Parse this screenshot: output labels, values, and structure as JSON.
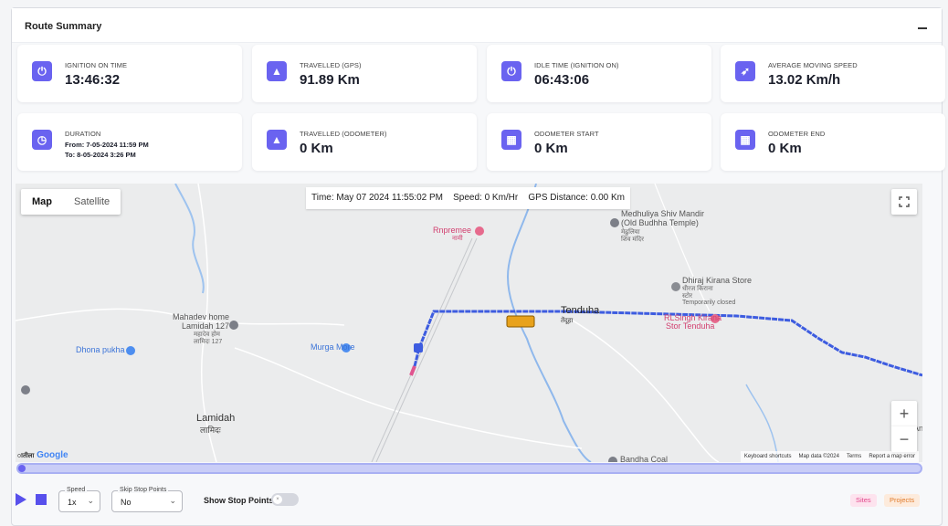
{
  "panel": {
    "title": "Route Summary"
  },
  "stats": [
    {
      "label": "IGNITION ON TIME",
      "value": "13:46:32",
      "icon": "power-icon"
    },
    {
      "label": "TRAVELLED (GPS)",
      "value": "91.89 Km",
      "icon": "road-icon"
    },
    {
      "label": "IDLE TIME (IGNITION ON)",
      "value": "06:43:06",
      "icon": "power-icon"
    },
    {
      "label": "AVERAGE MOVING SPEED",
      "value": "13.02 Km/h",
      "icon": "rocket-icon"
    },
    {
      "label": "DURATION",
      "from": "From: 7-05-2024 11:59 PM",
      "to": "To: 8-05-2024 3:26 PM",
      "icon": "clock-icon"
    },
    {
      "label": "TRAVELLED (ODOMETER)",
      "value": "0 Km",
      "icon": "road-icon"
    },
    {
      "label": "ODOMETER START",
      "value": "0 Km",
      "icon": "calculator-icon"
    },
    {
      "label": "ODOMETER END",
      "value": "0 Km",
      "icon": "calculator-icon"
    }
  ],
  "map": {
    "type_map": "Map",
    "type_satellite": "Satellite",
    "info": {
      "time": "Time: May 07 2024 11:55:02 PM",
      "speed": "Speed: 0 Km/Hr",
      "gps_distance": "GPS Distance: 0.00 Km"
    },
    "zoom_in": "+",
    "zoom_out": "−",
    "labels": {
      "temple_1": "Medhuliya Shiv Mandir",
      "temple_2": "(Old Budhha Temple)",
      "temple_3": "मेढुलिया",
      "temple_4": "शिव मंदिर",
      "rnpremee": "Rnpremee",
      "rnpremee_local": "नामी",
      "dhiraj_1": "Dhiraj Kirana Store",
      "dhiraj_2": "धीरज किराना",
      "dhiraj_3": "स्टोर",
      "dhiraj_4": "Temporarily closed",
      "tenduha": "Tenduha",
      "tenduha_local": "तेंदूहा",
      "rlsingh_1": "RLSingh Kirana",
      "rlsingh_2": "Stor Tenduha",
      "mahadev_1": "Mahadev home",
      "mahadev_2": "Lamidah 127",
      "mahadev_3": "महादेव होम",
      "mahadev_4": "लामिदः 127",
      "dhona": "Dhona pukha",
      "murga": "Murga More",
      "lamidah": "Lamidah",
      "lamidah_local": "लामिदः",
      "bandha": "Bandha Coal",
      "edge_an": "An"
    },
    "google": "Google",
    "google_prefix": "ातीला",
    "footer": [
      "Keyboard shortcuts",
      "Map data ©2024",
      "Terms",
      "Report a map error"
    ]
  },
  "controls": {
    "speed_label": "Speed",
    "speed_value": "1x",
    "skip_label": "Skip Stop Points",
    "skip_value": "No",
    "show_stop_points": "Show Stop Points",
    "switch_mark": "×",
    "sites": "Sites",
    "projects": "Projects"
  },
  "colors": {
    "accent": "#6a63f0",
    "route": "#3d5ce0",
    "route_start": "#e0558f",
    "sites": "#e2458a",
    "projects": "#e07a2a"
  }
}
